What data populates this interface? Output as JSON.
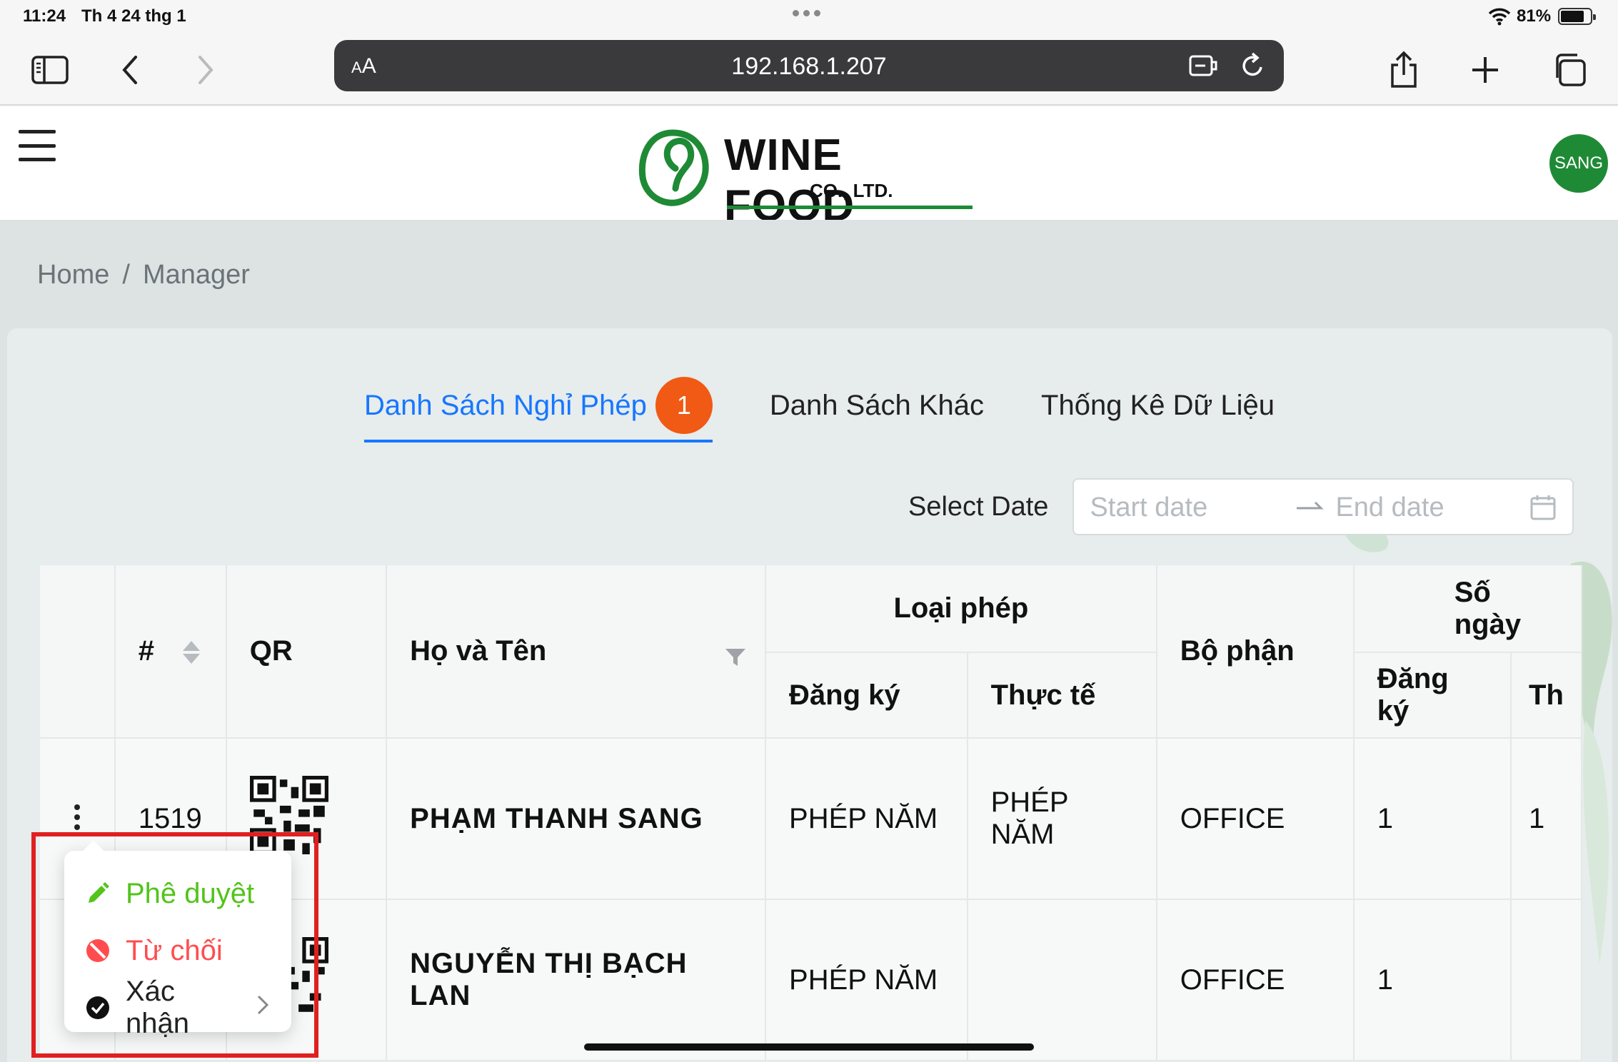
{
  "status_bar": {
    "time": "11:24",
    "date": "Th 4 24 thg 1",
    "battery": "81%"
  },
  "browser": {
    "aa_small": "A",
    "aa_big": "A",
    "url": "192.168.1.207"
  },
  "header": {
    "logo_name": "WINE FOOD",
    "logo_sub": "CO., LTD.",
    "avatar": "SANG",
    "brand_color": "#1f8a36"
  },
  "breadcrumb": {
    "home": "Home",
    "sep": "/",
    "current": "Manager"
  },
  "tabs": [
    {
      "label": "Danh Sách Nghỉ Phép",
      "badge": "1",
      "active": true
    },
    {
      "label": "Danh Sách Khác",
      "active": false
    },
    {
      "label": "Thống Kê Dữ Liệu",
      "active": false
    }
  ],
  "date_filter": {
    "label": "Select Date",
    "start_placeholder": "Start date",
    "end_placeholder": "End date"
  },
  "table": {
    "headers": {
      "id": "#",
      "qr": "QR",
      "name": "Họ và Tên",
      "leave_type": "Loại phép",
      "leave_type_registered": "Đăng ký",
      "leave_type_actual": "Thực tế",
      "department": "Bộ phận",
      "days": "Số ngày",
      "days_registered": "Đăng ký",
      "days_actual": "Th"
    },
    "rows": [
      {
        "id": "1519",
        "name": "PHẠM THANH SANG",
        "type_registered": "PHÉP NĂM",
        "type_actual": "PHÉP NĂM",
        "department": "OFFICE",
        "days_registered": "1",
        "days_actual": "1"
      },
      {
        "id": "",
        "name": "NGUYỄN THỊ BẠCH LAN",
        "type_registered": "PHÉP NĂM",
        "type_actual": "",
        "department": "OFFICE",
        "days_registered": "1",
        "days_actual": ""
      }
    ]
  },
  "row_menu": {
    "approve": "Phê duyệt",
    "reject": "Từ chối",
    "confirm": "Xác nhận"
  },
  "colors": {
    "accent": "#1677ff",
    "badge": "#f05a14",
    "approve": "#52c41a",
    "reject": "#ff4d4f",
    "highlight": "#e02020"
  }
}
